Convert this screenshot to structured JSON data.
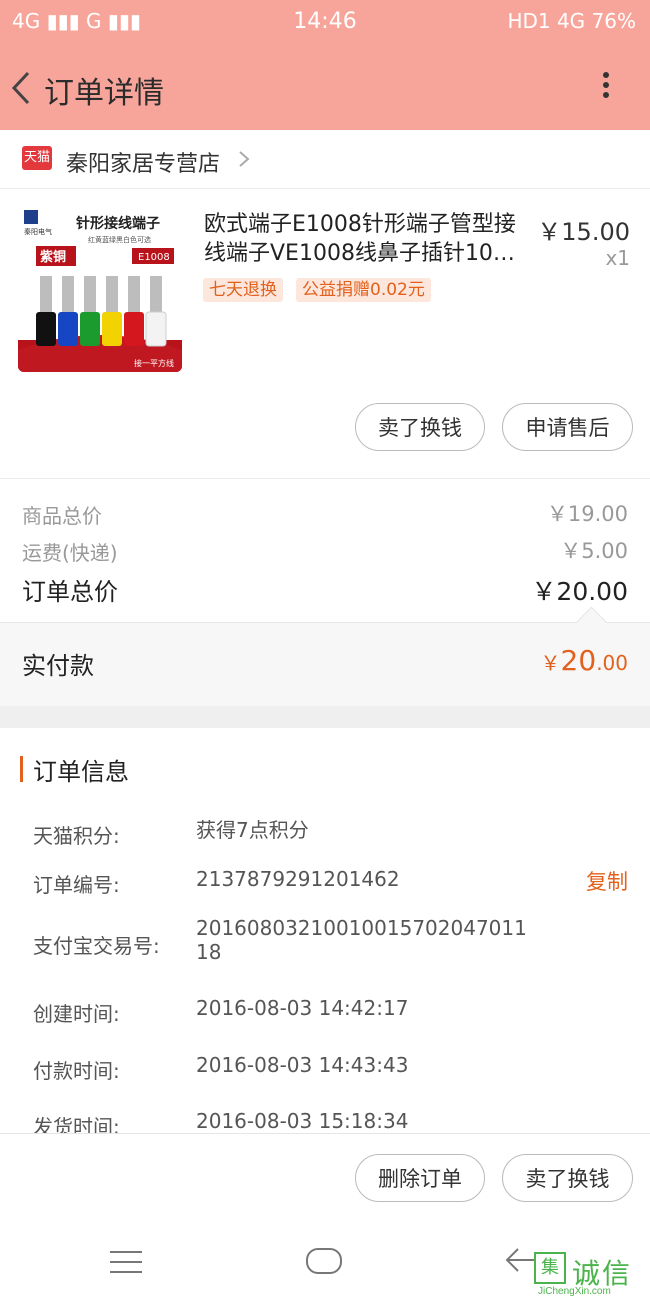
{
  "status_bar": {
    "left": "4G ▮▮▮ G ▮▮▮",
    "time": "14:46",
    "right": "HD1 4G 76%"
  },
  "header": {
    "title": "订单详情"
  },
  "store": {
    "badge": "天猫",
    "name": "秦阳家居专营店"
  },
  "product": {
    "image_text": {
      "brand": "秦阳电气",
      "heading": "针形接线端子",
      "subheading": "红黄蓝绿黑白色可选",
      "logo": "紫铜",
      "model": "E1008",
      "footer": "接一平方线"
    },
    "title": "欧式端子E1008针形端子管型接线端子VE1008线鼻子插针10…",
    "price": "￥15.00",
    "quantity": "x1",
    "tags": [
      "七天退换",
      "公益捐赠0.02元"
    ],
    "buttons": {
      "sell": "卖了换钱",
      "after_sale": "申请售后"
    }
  },
  "summary": {
    "goods_total_label": "商品总价",
    "goods_total_value": "￥19.00",
    "shipping_label": "运费(快递)",
    "shipping_value": "￥5.00",
    "order_total_label": "订单总价",
    "order_total_value": "￥20.00"
  },
  "paid": {
    "label": "实付款",
    "currency": "￥",
    "integer": "20",
    "decimal": ".00"
  },
  "order_info": {
    "title": "订单信息",
    "rows": [
      {
        "label": "天猫积分:",
        "value": "获得7点积分"
      },
      {
        "label": "订单编号:",
        "value": "2137879291201462"
      },
      {
        "label": "支付宝交易号:",
        "value": "2016080321001001570204701118"
      },
      {
        "label": "创建时间:",
        "value": "2016-08-03 14:42:17"
      },
      {
        "label": "付款时间:",
        "value": "2016-08-03 14:43:43"
      },
      {
        "label": "发货时间:",
        "value": "2016-08-03 15:18:34"
      }
    ],
    "copy_label": "复制"
  },
  "bottom_actions": {
    "delete": "删除订单",
    "sell": "卖了换钱"
  },
  "watermark": {
    "cn": "诚信",
    "en": "JiChengXin.com",
    "box": "集"
  },
  "colors": {
    "header_bg": "#f7a59b",
    "accent": "#e2611d",
    "tmall_red": "#e4393c"
  }
}
